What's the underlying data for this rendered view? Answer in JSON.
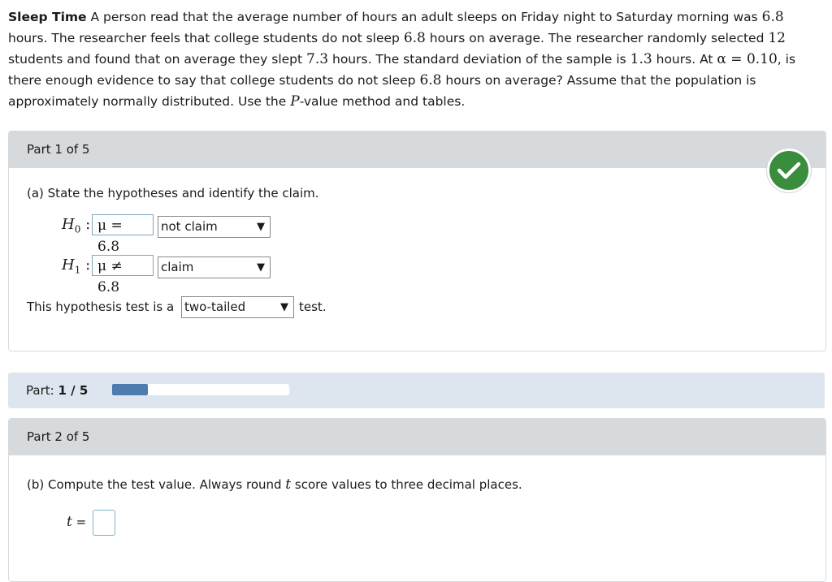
{
  "problem": {
    "title": "Sleep Time",
    "seg1": " A person read that the average number of hours an adult sleeps on Friday night to Saturday morning was ",
    "v1": "6.8",
    "seg2": " hours. The researcher feels that college students do not sleep ",
    "v2": "6.8",
    "seg3": " hours on average. The researcher randomly selected ",
    "v3": "12",
    "seg4": " students and found that on average they slept ",
    "v4": "7.3",
    "seg5": " hours. The standard deviation of the sample is ",
    "v5": "1.3",
    "seg6": " hours. At ",
    "alpha": "α = 0.10",
    "seg7": ", is there enough evidence to say that college students do not sleep ",
    "v6": "6.8",
    "seg8": " hours on average? Assume that the population is approximately normally distributed. Use the ",
    "pvar": "P",
    "seg9": "-value method and tables."
  },
  "part1": {
    "header": "Part 1 of 5",
    "question": "(a) State the hypotheses and identify the claim.",
    "h0_label": "H",
    "h0_sub": "0",
    "h0_value": "μ = 6.8",
    "h0_select": "not claim",
    "h1_label": "H",
    "h1_sub": "1",
    "h1_value": "μ ≠ 6.8",
    "h1_select": "claim",
    "test_prefix": "This hypothesis test is a",
    "test_select": "two-tailed",
    "test_suffix": "test.",
    "status_icon": "check-circle-icon"
  },
  "progress": {
    "label": "Part:",
    "value": "1 / 5",
    "fraction": 0.2,
    "color": "#4f7cae"
  },
  "part2": {
    "header": "Part 2 of 5",
    "question_pre": "(b) Compute the test value. Always round ",
    "question_var": "t",
    "question_post": " score values to three decimal places.",
    "t_label": "t",
    "equals": "=",
    "t_value": ""
  },
  "colors": {
    "check": "#3a8d3c",
    "panel_header": "#d6dadd",
    "progress_bg": "#dde6ee"
  }
}
